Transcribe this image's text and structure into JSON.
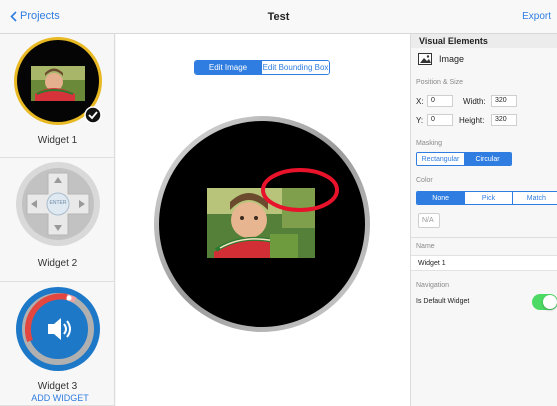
{
  "topbar": {
    "back_label": "Projects",
    "title": "Test",
    "export_label": "Export"
  },
  "sidebar": {
    "widgets": [
      {
        "label": "Widget 1"
      },
      {
        "label": "Widget 2"
      },
      {
        "label": "Widget 3"
      }
    ],
    "dpad_center_label": "ENTER",
    "add_widget_label": "ADD WIDGET"
  },
  "canvas": {
    "edit_image_label": "Edit Image",
    "edit_bbox_label": "Edit Bounding Box"
  },
  "panel": {
    "header": "Visual Elements",
    "element_label": "Image",
    "position_size_label": "Position & Size",
    "x_label": "X:",
    "x_value": "0",
    "y_label": "Y:",
    "y_value": "0",
    "width_label": "Width:",
    "width_value": "320",
    "height_label": "Height:",
    "height_value": "320",
    "masking_label": "Masking",
    "masking_options": [
      "Rectangular",
      "Circular"
    ],
    "masking_selected": "Circular",
    "color_label": "Color",
    "color_options": [
      "None",
      "Pick",
      "Match"
    ],
    "color_selected": "None",
    "color_value": "N/A",
    "name_label": "Name",
    "name_value": "Widget 1",
    "navigation_label": "Navigation",
    "default_widget_label": "Is Default Widget",
    "default_widget_on": true
  },
  "colors": {
    "accent": "#2f7de1",
    "toggle_on": "#4cd964",
    "highlight_ring": "#e8122b"
  }
}
